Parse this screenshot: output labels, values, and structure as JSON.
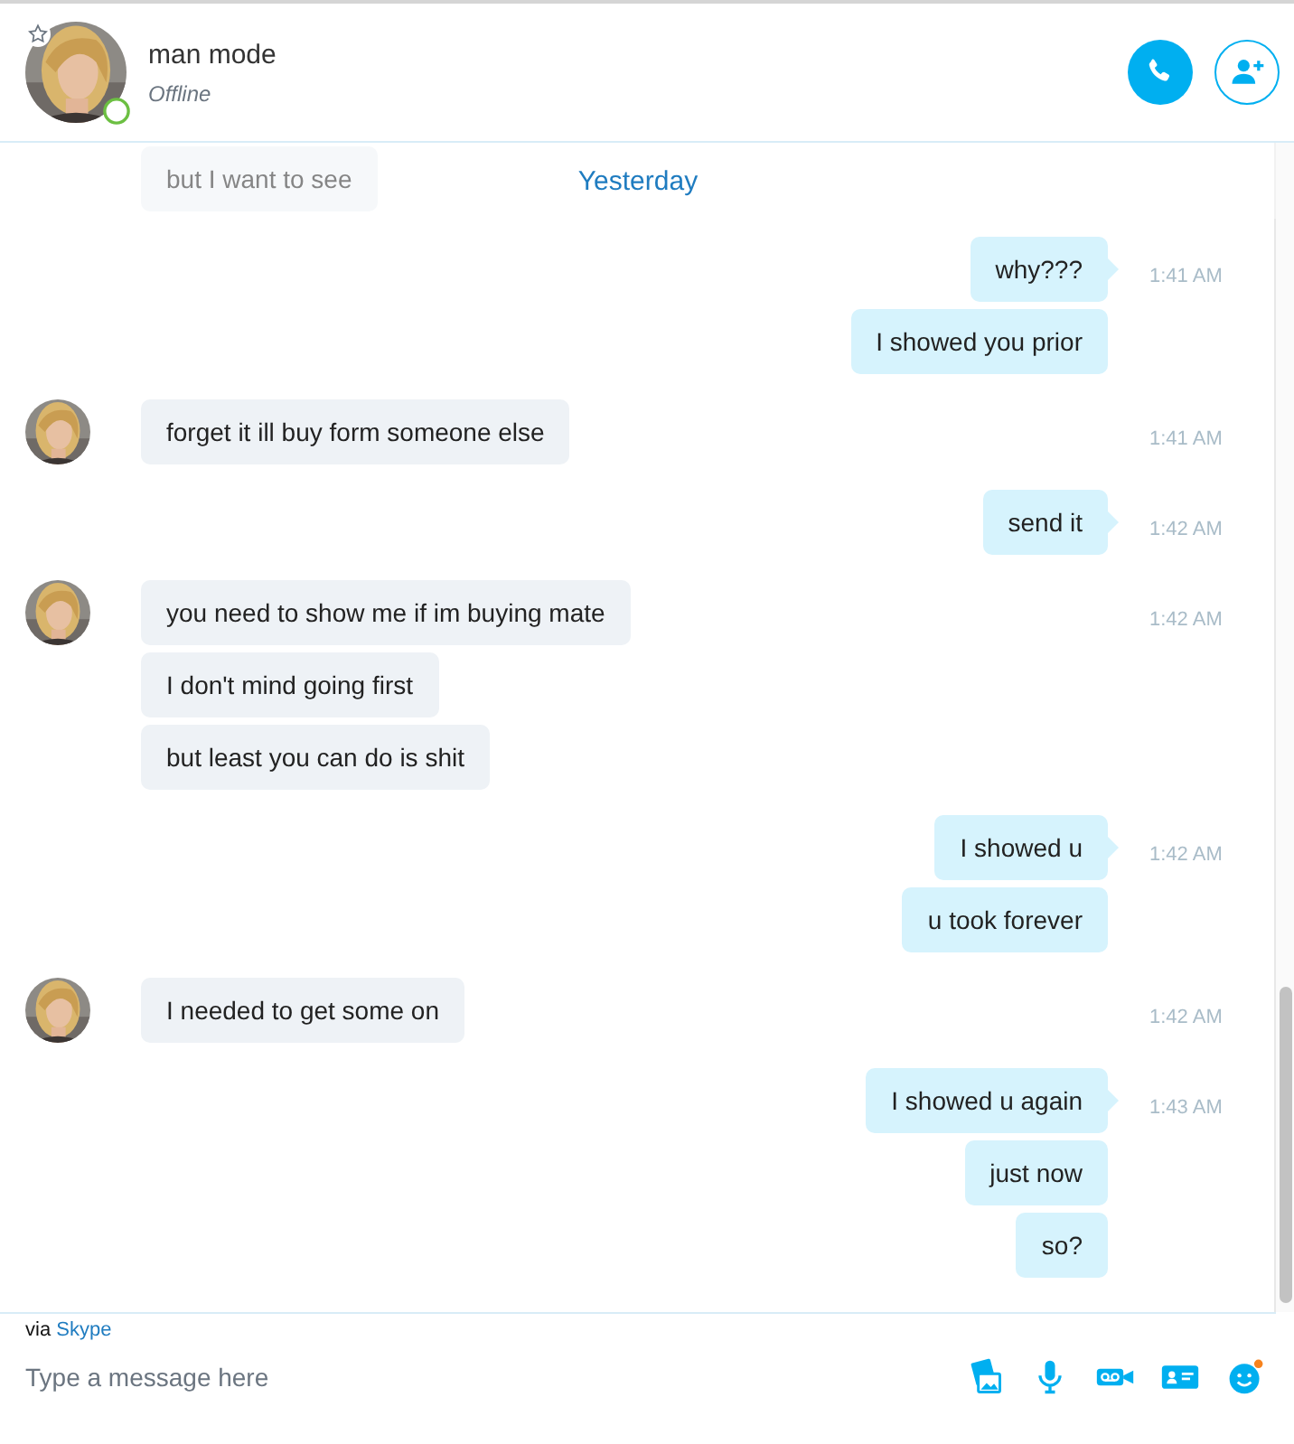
{
  "contact": {
    "name": "man mode",
    "status": "Offline",
    "favorite": true
  },
  "date_banner": "Yesterday",
  "groups": [
    {
      "kind": "incoming",
      "messages": [
        "but I want to see"
      ]
    },
    {
      "kind": "outgoing",
      "time": "1:41 AM",
      "messages": [
        "why???",
        "I showed you prior"
      ]
    },
    {
      "kind": "incoming",
      "time": "1:41 AM",
      "messages": [
        "forget it ill buy form someone else"
      ]
    },
    {
      "kind": "outgoing",
      "time": "1:42 AM",
      "messages": [
        "send it"
      ]
    },
    {
      "kind": "incoming",
      "time": "1:42 AM",
      "messages": [
        "you need to show me if im buying mate",
        "I don't mind going first",
        "but least you can do is shit"
      ]
    },
    {
      "kind": "outgoing",
      "time": "1:42 AM",
      "messages": [
        "I showed u",
        "u took forever"
      ]
    },
    {
      "kind": "incoming",
      "time": "1:42 AM",
      "messages": [
        "I needed to get some on"
      ]
    },
    {
      "kind": "outgoing",
      "time": "1:43 AM",
      "messages": [
        "I showed u again",
        "just now",
        "so?"
      ]
    }
  ],
  "via": {
    "prefix": "via",
    "service": "Skype"
  },
  "composer": {
    "placeholder": "Type a message here",
    "emoji_notification": true
  }
}
